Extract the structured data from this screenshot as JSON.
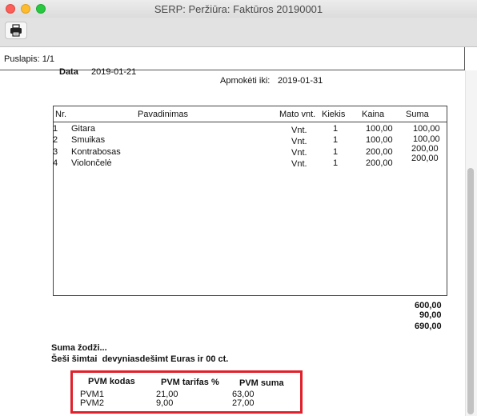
{
  "window": {
    "title": "SERP: Peržiūra: Faktūros 20190001"
  },
  "pagebar": {
    "label": "Puslapis: 1/1"
  },
  "invoice": {
    "date_label": "Data",
    "date_value": "2019-01-21",
    "due_label": "Apmokėti iki:",
    "due_value": "2019-01-31",
    "columns": [
      "Nr.",
      "Pavadinimas",
      "Mato vnt.",
      "Kiekis",
      "Kaina",
      "Suma"
    ],
    "rows": [
      {
        "nr": "1",
        "name": "Gitara",
        "unit": "Vnt.",
        "qty": "1",
        "price": "100,00",
        "sum": "100,00"
      },
      {
        "nr": "2",
        "name": "Smuikas",
        "unit": "Vnt.",
        "qty": "1",
        "price": "100,00",
        "sum": "100,00"
      },
      {
        "nr": "3",
        "name": "Kontrabosas",
        "unit": "Vnt.",
        "qty": "1",
        "price": "200,00",
        "sum": "200,00"
      },
      {
        "nr": "4",
        "name": "Violončelė",
        "unit": "Vnt.",
        "qty": "1",
        "price": "200,00",
        "sum": "200,00"
      }
    ],
    "totals": [
      "600,00",
      "90,00",
      "690,00"
    ],
    "words_label": "Suma žodži...",
    "words_value": "Šeši šimtai  devyniasdešimt Euras ir 00 ct."
  },
  "vat": {
    "headers": [
      "PVM kodas",
      "PVM tarifas %",
      "PVM suma"
    ],
    "rows": [
      {
        "code": "PVM1",
        "rate": "21,00",
        "amount": "63,00"
      },
      {
        "code": "PVM2",
        "rate": "9,00",
        "amount": "27,00"
      }
    ]
  },
  "colors": {
    "highlight": "#e0202a"
  }
}
